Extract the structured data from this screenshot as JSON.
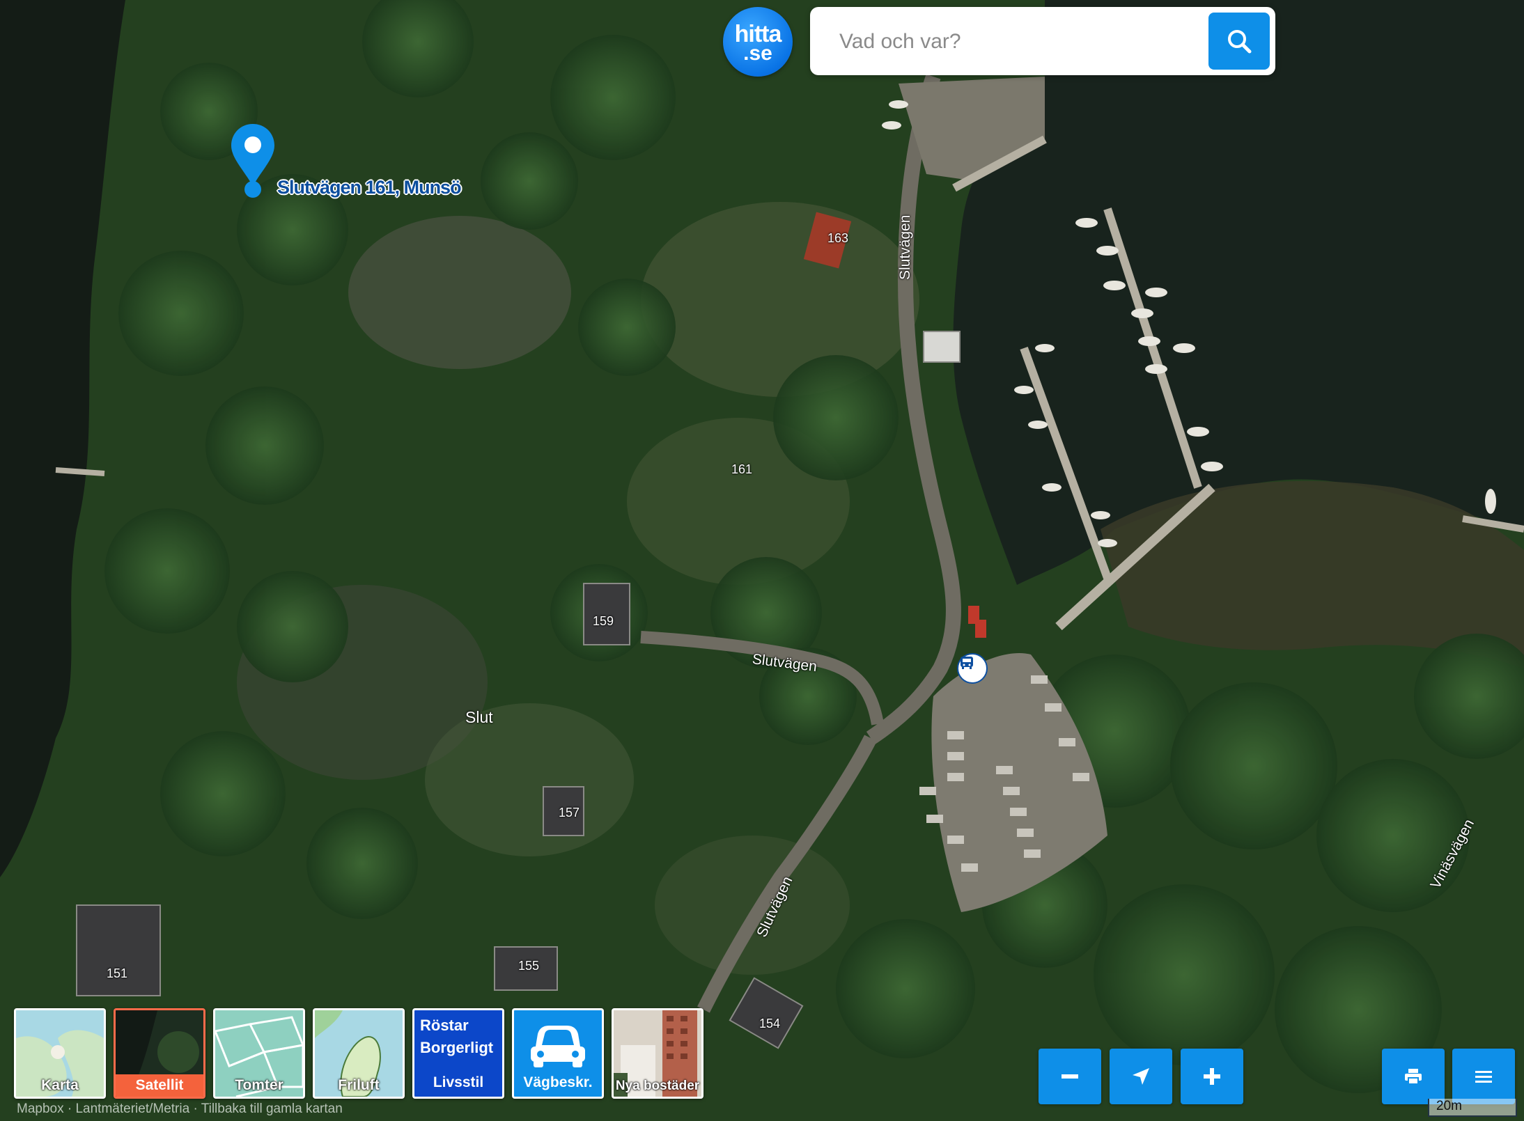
{
  "search": {
    "placeholder": "Vad och var?"
  },
  "logo": {
    "line1": "hitta",
    "line2": ".se"
  },
  "pin": {
    "label": "Slutvägen 161, Munsö"
  },
  "map_labels": {
    "house_151": "151",
    "house_154": "154",
    "house_155": "155",
    "house_157": "157",
    "house_159": "159",
    "house_161": "161",
    "house_163": "163",
    "place_slut": "Slut",
    "road_slutvagen_1": "Slutvägen",
    "road_slutvagen_2": "Slutvägen",
    "road_slutvagen_3": "Slutvägen",
    "road_vinasvagen": "Vinäsvägen"
  },
  "layers": [
    {
      "label": "Karta",
      "selected": false
    },
    {
      "label": "Satellit",
      "selected": true
    },
    {
      "label": "Tomter",
      "selected": false
    },
    {
      "label": "Friluft",
      "selected": false
    },
    {
      "label_line1": "Röstar",
      "label_line2": "Borgerligt",
      "label_line3": "Livsstil"
    },
    {
      "label": "Vägbeskr."
    },
    {
      "label": "Nya bostäder"
    }
  ],
  "controls": {
    "zoom_out": "zoom-out",
    "locate": "locate",
    "zoom_in": "zoom-in",
    "print": "print",
    "menu": "menu"
  },
  "attribution": "Mapbox · Lantmäteriet/Metria · Tillbaka till gamla kartan",
  "scale_label": "20m",
  "colors": {
    "accent": "#0e8fe8",
    "selected_layer": "#f4623c",
    "pin": "#0e8fe8"
  }
}
